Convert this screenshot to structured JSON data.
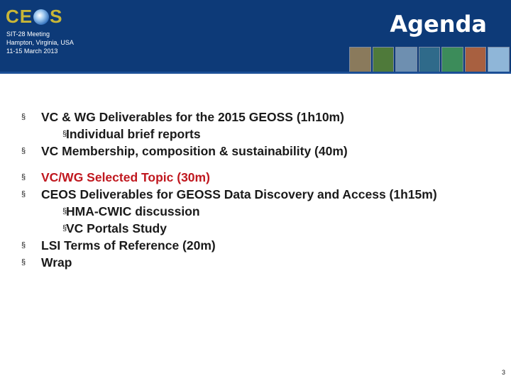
{
  "header": {
    "logo_text": "CEOS",
    "meeting_lines": [
      "SIT-28 Meeting",
      "Hampton, Virginia, USA",
      "11-15 March 2013"
    ],
    "title": "Agenda",
    "thumbnail_colors": [
      "#8a7a5c",
      "#4f7a3a",
      "#6e8fb0",
      "#2f6a8a",
      "#3c8c5a",
      "#a86040",
      "#8fb6d8"
    ]
  },
  "bullet_symbol": "§",
  "agenda": {
    "items": [
      {
        "text": "VC & WG Deliverables for the 2015 GEOSS (1h10m)",
        "level": 1
      },
      {
        "text": "Individual brief reports",
        "level": 2
      },
      {
        "text": "VC Membership, composition & sustainability (40m)",
        "level": 1
      },
      {
        "text": "VC/WG Selected Topic (30m)",
        "level": 1,
        "color": "#c0181f"
      },
      {
        "text": "CEOS Deliverables for GEOSS Data Discovery and Access (1h15m)",
        "level": 1
      },
      {
        "text": "HMA-CWIC discussion",
        "level": 2
      },
      {
        "text": "VC Portals Study",
        "level": 2
      },
      {
        "text": "LSI Terms of Reference (20m)",
        "level": 1
      },
      {
        "text": "Wrap",
        "level": 1
      }
    ]
  },
  "page_number": "3"
}
